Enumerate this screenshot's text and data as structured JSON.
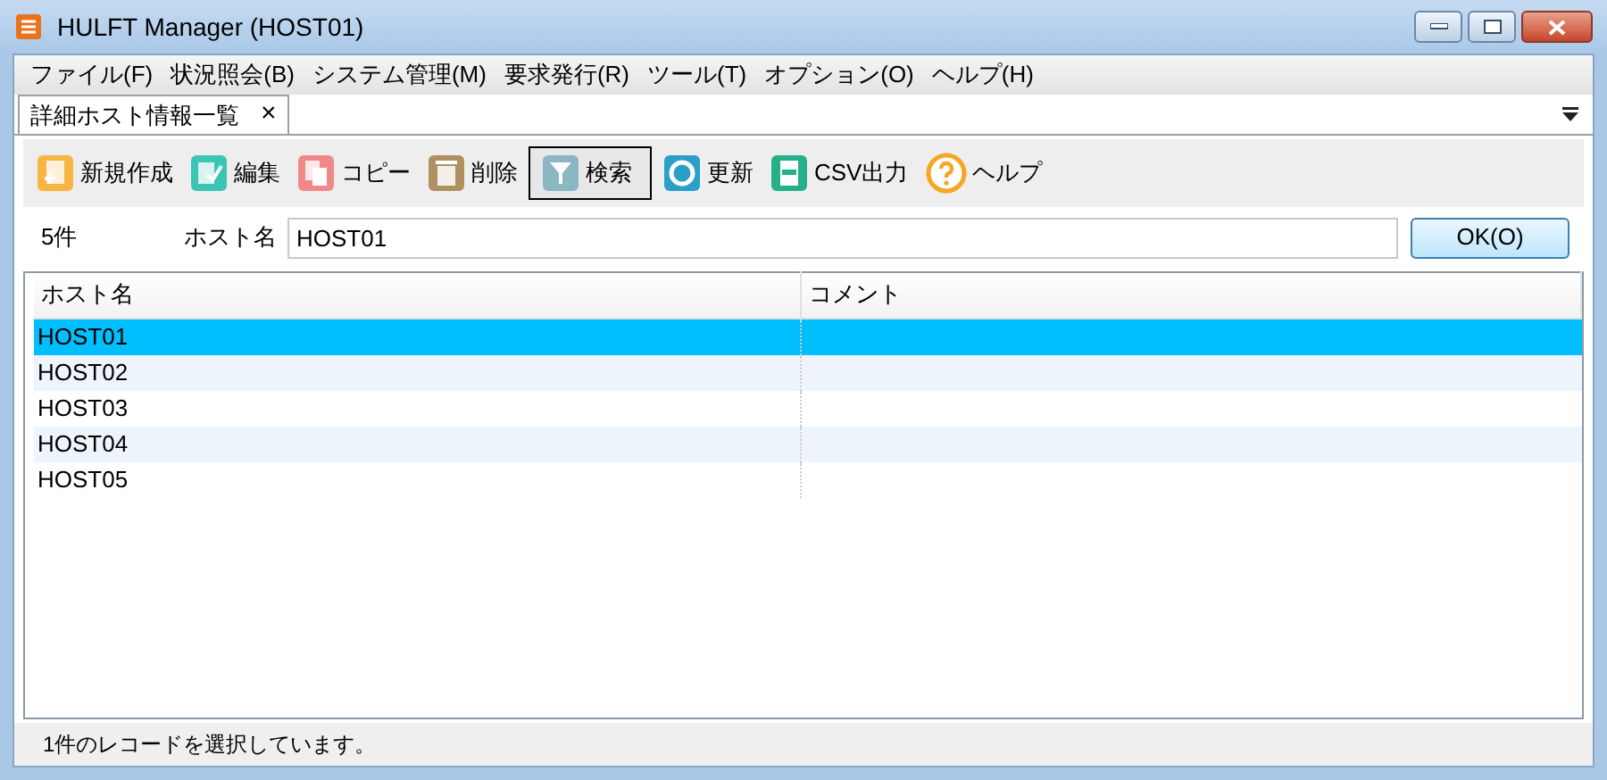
{
  "window": {
    "title": "HULFT Manager (HOST01)"
  },
  "menu": [
    "ファイル(F)",
    "状況照会(B)",
    "システム管理(M)",
    "要求発行(R)",
    "ツール(T)",
    "オプション(O)",
    "ヘルプ(H)"
  ],
  "tabs": [
    {
      "label": "詳細ホスト情報一覧",
      "close": "×",
      "selected": true
    }
  ],
  "toolbar": [
    {
      "label": "新規作成",
      "pressed": false
    },
    {
      "label": "編集",
      "pressed": false
    },
    {
      "label": "コピー",
      "pressed": false
    },
    {
      "label": "削除",
      "pressed": false
    },
    {
      "label": "検索",
      "pressed": true
    },
    {
      "label": "更新",
      "pressed": false
    },
    {
      "label": "CSV出力",
      "pressed": false
    },
    {
      "label": "ヘルプ",
      "pressed": false
    }
  ],
  "search": {
    "count": "5件",
    "label": "ホスト名",
    "value": "HOST01",
    "button": "OK(O)"
  },
  "table": {
    "columns": [
      "ホスト名",
      "コメント"
    ],
    "rows": [
      {
        "host": "HOST01",
        "selected": true
      },
      {
        "host": "HOST02",
        "selected": false
      },
      {
        "host": "HOST03",
        "selected": false
      },
      {
        "host": "HOST04",
        "selected": false
      },
      {
        "host": "HOST05",
        "selected": false
      }
    ]
  },
  "status_bar": "1件のレコードを選択しています。"
}
